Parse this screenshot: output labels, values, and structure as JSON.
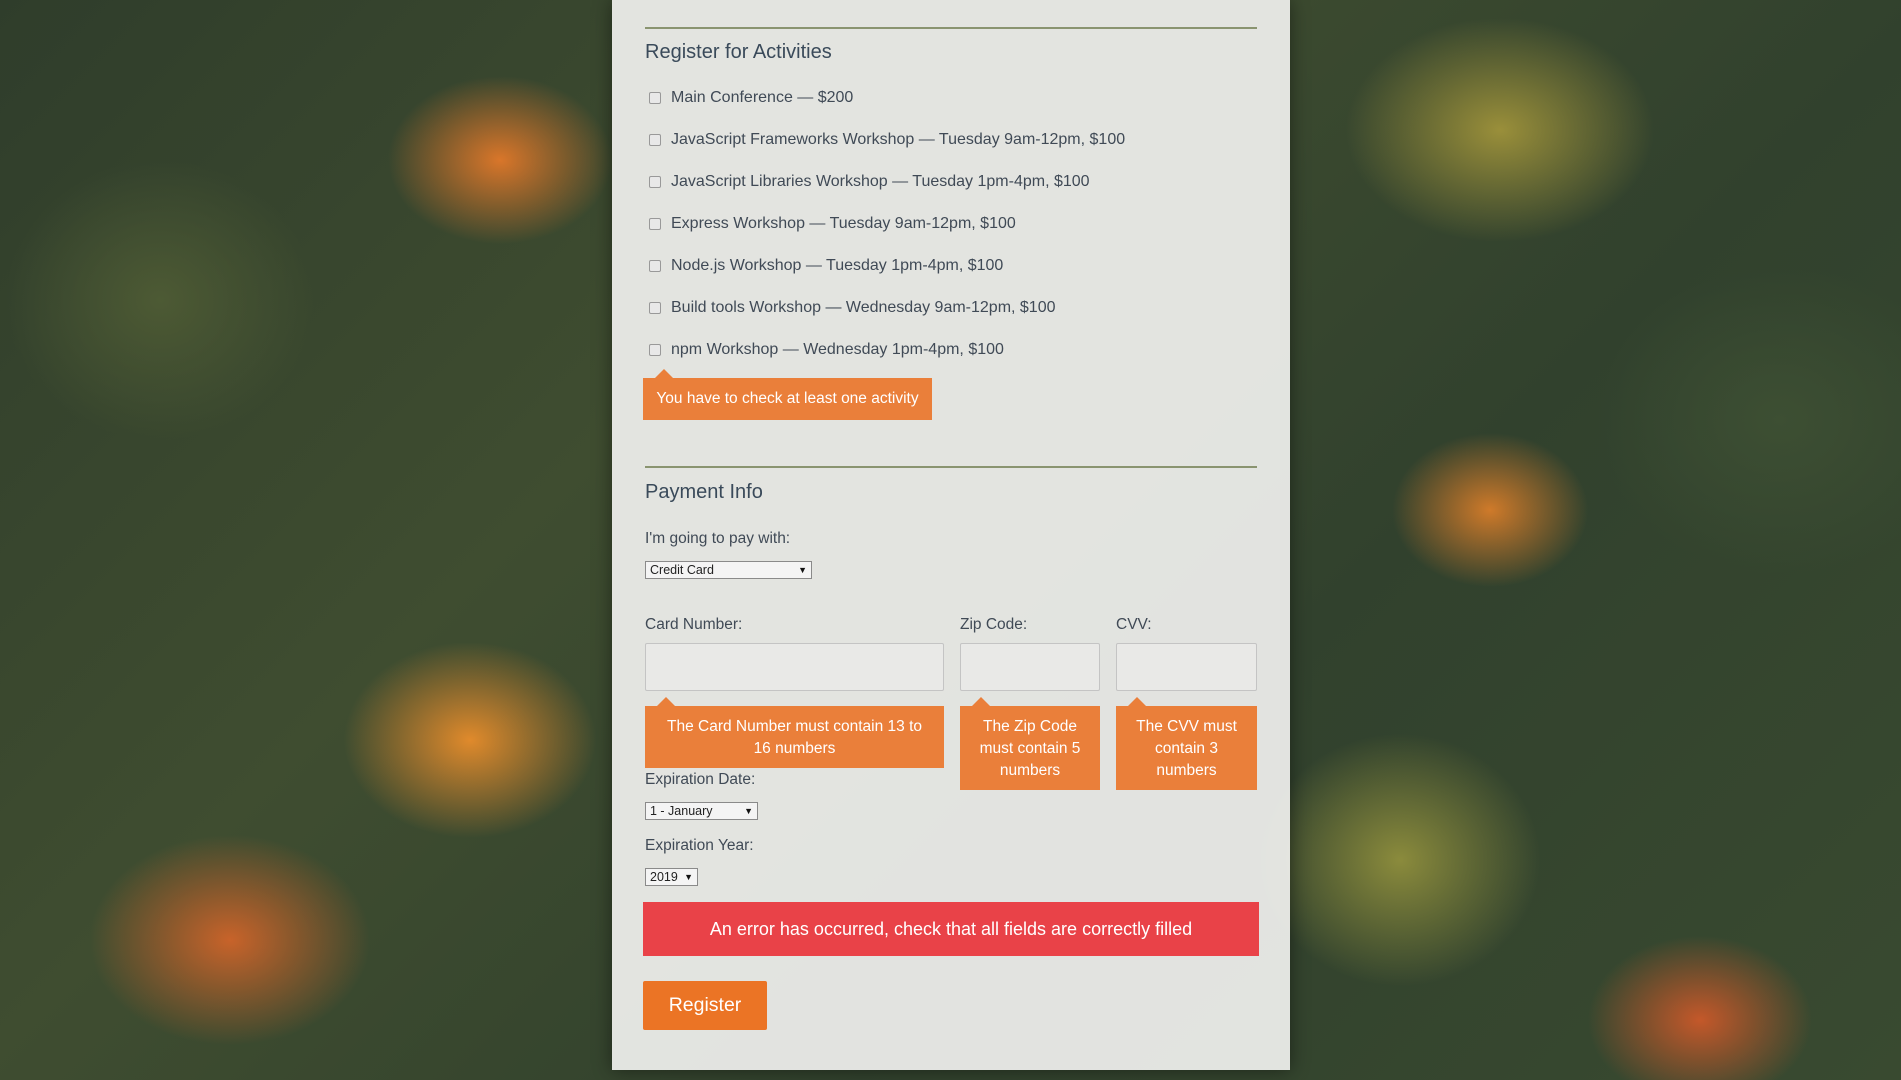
{
  "activities": {
    "heading": "Register for Activities",
    "items": [
      "Main Conference — $200",
      "JavaScript Frameworks Workshop — Tuesday 9am-12pm, $100",
      "JavaScript Libraries Workshop — Tuesday 1pm-4pm, $100",
      "Express Workshop — Tuesday 9am-12pm, $100",
      "Node.js Workshop — Tuesday 1pm-4pm, $100",
      "Build tools Workshop — Wednesday 9am-12pm, $100",
      "npm Workshop — Wednesday 1pm-4pm, $100"
    ],
    "error": "You have to check at least one activity"
  },
  "payment": {
    "heading": "Payment Info",
    "method_label": "I'm going to pay with:",
    "method_value": "Credit Card",
    "card_label": "Card Number:",
    "card_value": "",
    "card_error": "The Card Number must contain 13 to 16 numbers",
    "zip_label": "Zip Code:",
    "zip_value": "",
    "zip_error": "The Zip Code must contain 5 numbers",
    "cvv_label": "CVV:",
    "cvv_value": "",
    "cvv_error": "The CVV must contain 3 numbers",
    "exp_date_label": "Expiration Date:",
    "exp_date_value": "1 - January",
    "exp_year_label": "Expiration Year:",
    "exp_year_value": "2019"
  },
  "form_error": "An error has occurred, check that all fields are correctly filled",
  "register_label": "Register",
  "colors": {
    "tooltip": "#ea7f3a",
    "error_banner": "#e94248",
    "button": "#eb7425"
  }
}
